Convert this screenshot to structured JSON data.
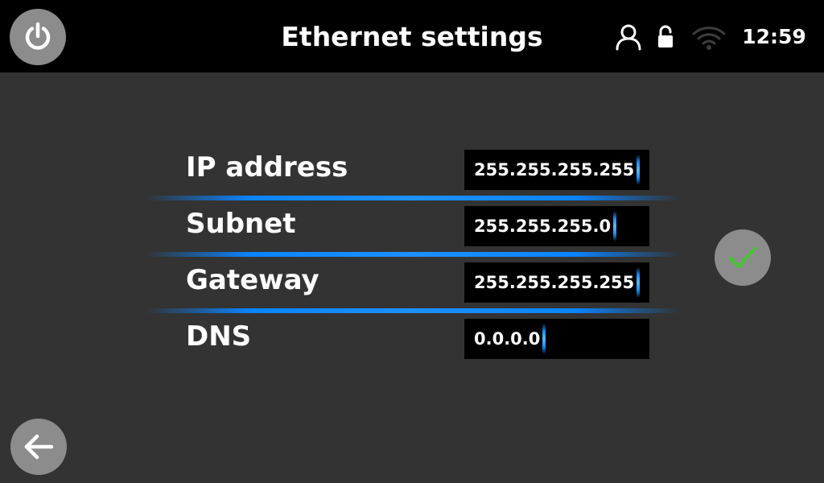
{
  "header": {
    "title": "Ethernet settings",
    "time": "12:59",
    "icons": {
      "power": "power-icon",
      "user": "user-icon",
      "lock": "unlocked-icon",
      "wifi": "wifi-icon"
    }
  },
  "fields": [
    {
      "label": "IP address",
      "value": "255.255.255.255"
    },
    {
      "label": "Subnet",
      "value": "255.255.255.0"
    },
    {
      "label": "Gateway",
      "value": "255.255.255.255"
    },
    {
      "label": "DNS",
      "value": "0.0.0.0"
    }
  ],
  "actions": {
    "confirm_icon": "checkmark-icon",
    "back_icon": "back-arrow-icon"
  },
  "colors": {
    "accent": "#1e8cff",
    "confirm": "#4cbf3a",
    "button_bg": "#8c8c8c",
    "panel_bg": "#333333",
    "topbar_bg": "#000000"
  }
}
